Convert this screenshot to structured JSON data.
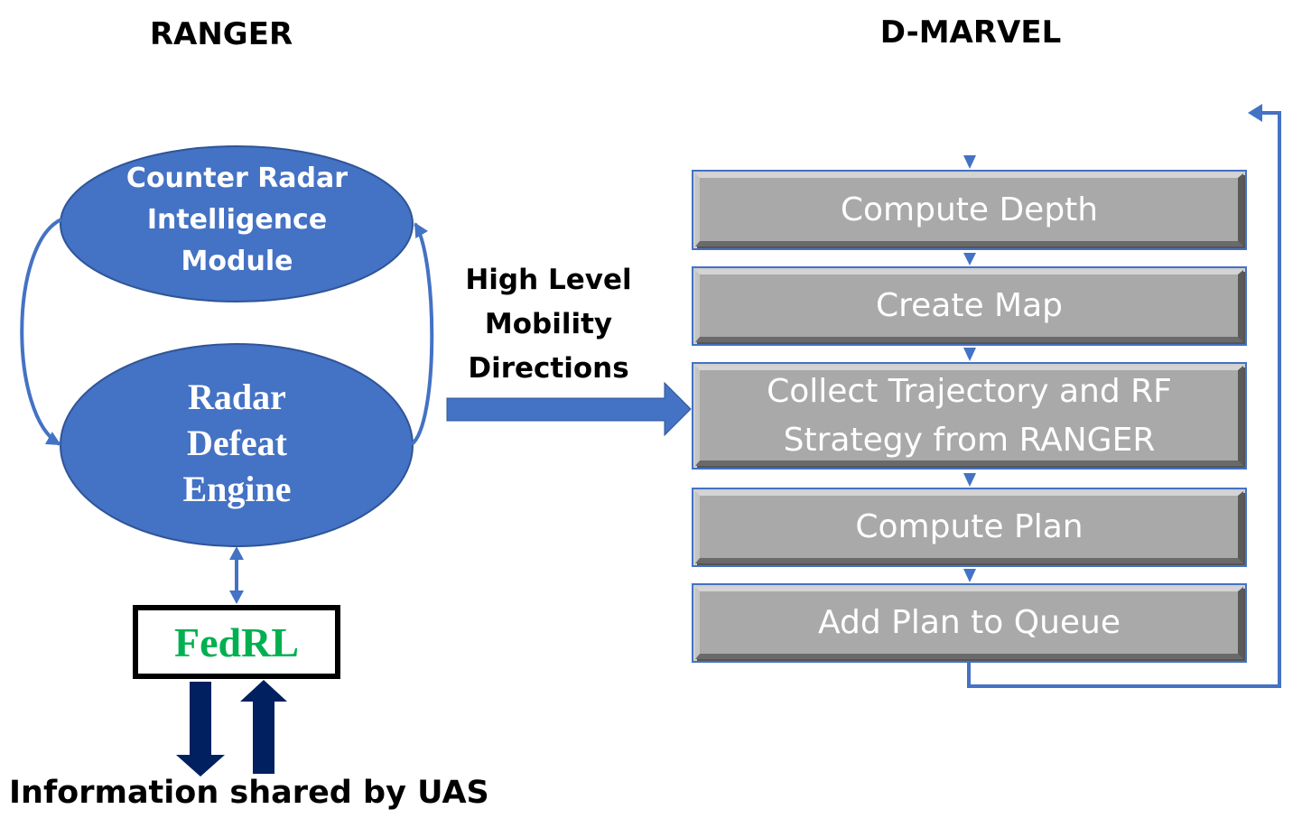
{
  "ranger": {
    "title": "RANGER",
    "counter_radar_module": [
      "Counter Radar",
      "Intelligence",
      "Module"
    ],
    "radar_defeat_engine": [
      "Radar",
      "Defeat",
      "Engine"
    ],
    "fedrl_label": "FedRL",
    "fedrl_color": "#00b050",
    "information_label": "Information shared by UAS"
  },
  "connector": {
    "label": [
      "High Level",
      "Mobility",
      "Directions"
    ]
  },
  "dmarvel": {
    "title": "D-MARVEL",
    "steps": [
      {
        "lines": [
          "Compute Depth"
        ]
      },
      {
        "lines": [
          "Create Map"
        ]
      },
      {
        "lines": [
          "Collect Trajectory and RF",
          "Strategy from RANGER"
        ]
      },
      {
        "lines": [
          "Compute Plan"
        ]
      },
      {
        "lines": [
          "Add Plan to Queue"
        ]
      }
    ]
  },
  "colors": {
    "accent_blue": "#4472c4",
    "navy_arrow": "#002060",
    "step_fill": "#a9a9a9"
  }
}
